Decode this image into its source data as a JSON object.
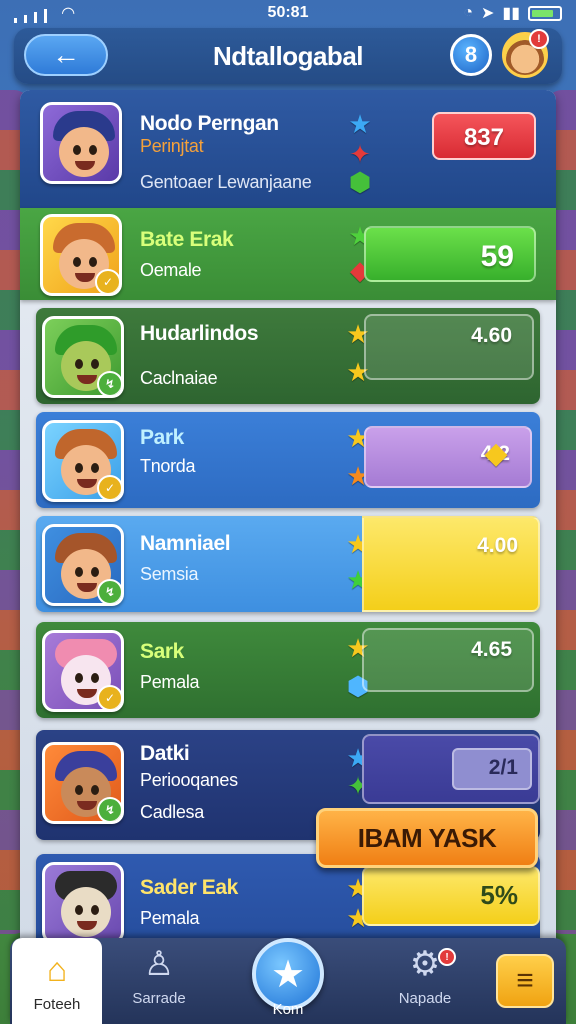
{
  "status_bar": {
    "time": "50:81",
    "wifi_icon": "wifi-icon",
    "signal_icon": "signal-icon",
    "battery_icon": "battery-icon"
  },
  "header": {
    "back_icon": "back-arrow-icon",
    "title": "Ndtallogabal",
    "level_badge": "8",
    "notification_count": "!"
  },
  "rows": [
    {
      "name": "Nodo Perngan",
      "sub1": "Perinjtat",
      "sub2": "Gentoaer Lewanjaane",
      "score": "837",
      "gems": [
        "blue-star",
        "red-gem",
        "green-gem"
      ]
    },
    {
      "name": "Bate Erak",
      "sub1": "Oemale",
      "score": "59",
      "gems": [
        "green-star",
        "red-gem"
      ]
    },
    {
      "name": "Hudarlindos",
      "sub1": "Caclnaiae",
      "score": "4.60",
      "gems": [
        "gold-star",
        "gold-star"
      ]
    },
    {
      "name": "Park",
      "sub1": "Tnorda",
      "score": "4.2",
      "gems": [
        "gold-star",
        "orange-star"
      ]
    },
    {
      "name": "Namniael",
      "sub1": "Semsia",
      "score": "4.00",
      "gems": [
        "gold-star",
        "green-star"
      ]
    },
    {
      "name": "Sark",
      "sub1": "Pemala",
      "score": "4.65",
      "gems": [
        "gold-star",
        "blue-gem"
      ]
    },
    {
      "name": "Datki",
      "sub1": "Periooqanes",
      "sub2": "Cadlesa",
      "score": "2/1",
      "gems": [
        "blue-star",
        "green-gem"
      ]
    },
    {
      "name": "Sader Eak",
      "sub1": "Pemala",
      "score": "5%",
      "gems": [
        "gold-star",
        "gold-star"
      ]
    }
  ],
  "team_button": {
    "label": "IBAM YASK"
  },
  "nav": {
    "home": "Foteeh",
    "second": "Sarrade",
    "center": "Kom",
    "settings": "Napade",
    "settings_badge": "!",
    "menu_icon": "menu-icon"
  },
  "colors": {
    "accent": "#2f7bd8",
    "red_score": "#e5383f",
    "green_bar": "#49b53a",
    "yellow_bar": "#f7dd3c",
    "purple_bar": "#b58ad9"
  }
}
